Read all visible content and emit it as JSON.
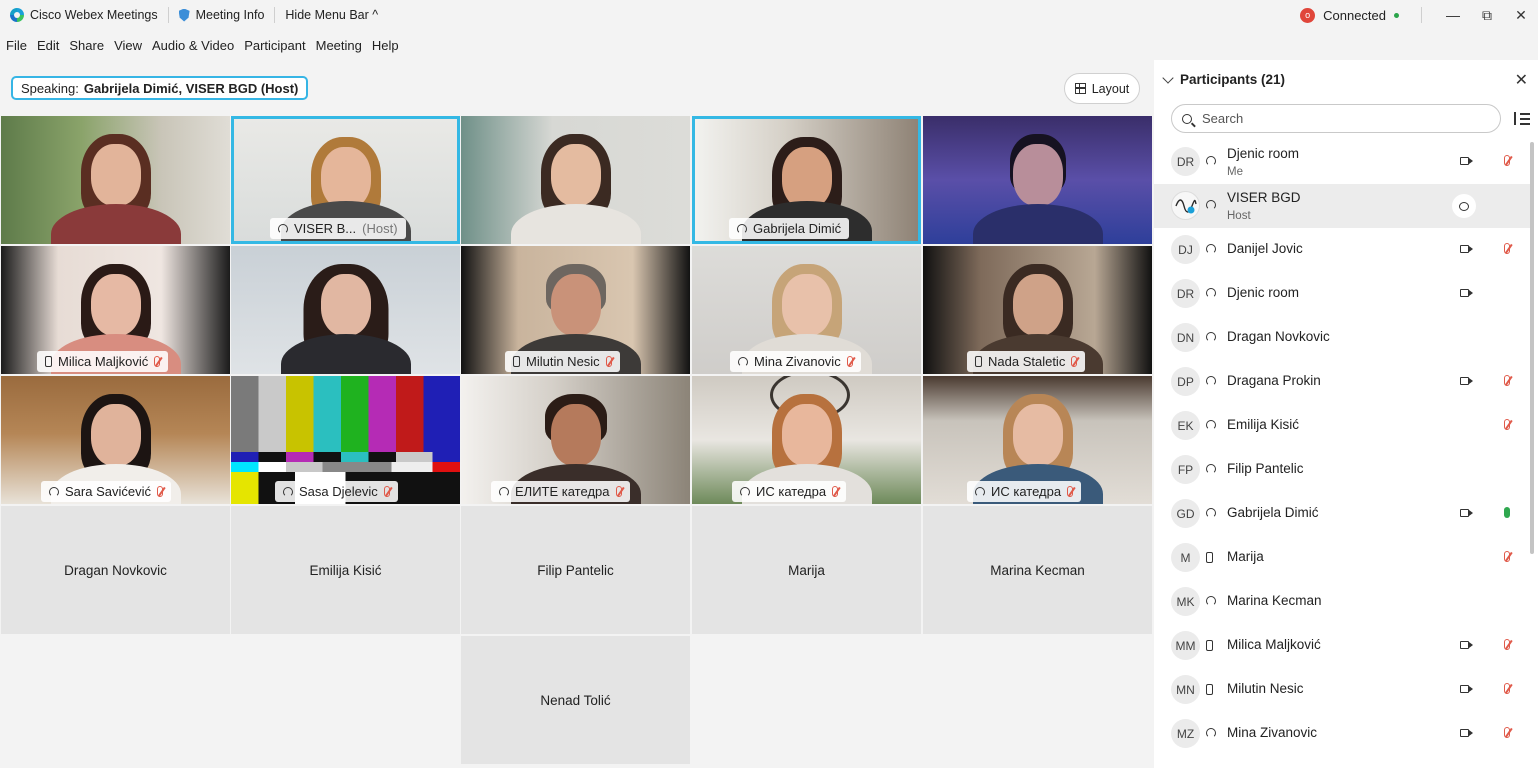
{
  "titlebar": {
    "app_name": "Cisco Webex Meetings",
    "meeting_info": "Meeting Info",
    "hide_menu": "Hide Menu Bar ^",
    "status": "Connected",
    "rec_badge": "o",
    "minimize": "—",
    "restore": "⧉",
    "close": "✕"
  },
  "menu": [
    "File",
    "Edit",
    "Share",
    "View",
    "Audio & Video",
    "Participant",
    "Meeting",
    "Help"
  ],
  "speaking": {
    "label": "Speaking:",
    "name": "Gabrijela Dimić, VISER BGD (Host)"
  },
  "layout_button": "Layout",
  "video_tiles": [
    {
      "name": "",
      "host": "",
      "icon": "none",
      "muted": false
    },
    {
      "name": "VISER B...",
      "host": "(Host)",
      "icon": "audio",
      "muted": false,
      "active": true
    },
    {
      "name": "",
      "host": "",
      "icon": "none",
      "muted": false
    },
    {
      "name": "Gabrijela Dimić",
      "host": "",
      "icon": "audio",
      "muted": false,
      "active": true
    },
    {
      "name": "",
      "host": "",
      "icon": "none",
      "muted": false
    },
    {
      "name": "Milica Maljković",
      "host": "",
      "icon": "phone",
      "muted": true
    },
    {
      "name": "",
      "host": "",
      "icon": "none",
      "muted": false
    },
    {
      "name": "Milutin Nesic",
      "host": "",
      "icon": "phone",
      "muted": true
    },
    {
      "name": "Mina Zivanovic",
      "host": "",
      "icon": "audio",
      "muted": true
    },
    {
      "name": "Nada Staletic",
      "host": "",
      "icon": "phone",
      "muted": true
    },
    {
      "name": "Sara Savićević",
      "host": "",
      "icon": "audio",
      "muted": true
    },
    {
      "name": "Sasa Djelevic",
      "host": "",
      "icon": "audio",
      "muted": true
    },
    {
      "name": "ЕЛИТЕ катедра",
      "host": "",
      "icon": "audio",
      "muted": true
    },
    {
      "name": "ИС катедра",
      "host": "",
      "icon": "audio",
      "muted": true
    },
    {
      "name": "ИС катедра",
      "host": "",
      "icon": "audio",
      "muted": true
    }
  ],
  "name_tiles": [
    "Dragan Novkovic",
    "Emilija Kisić",
    "Filip Pantelic",
    "Marija",
    "Marina Kecman",
    "Nenad Tolić"
  ],
  "panel": {
    "title": "Participants (21)",
    "close": "✕",
    "search_placeholder": "Search",
    "participants": [
      {
        "initials": "DR",
        "name": "Djenic room",
        "sub": "Me",
        "icon": "audio",
        "cam": true,
        "mic": "muted"
      },
      {
        "initials": "",
        "name": "VISER BGD",
        "sub": "Host",
        "icon": "audio",
        "cam": false,
        "mic": "chat",
        "selected": true
      },
      {
        "initials": "DJ",
        "name": "Danijel Jovic",
        "sub": "",
        "icon": "audio",
        "cam": true,
        "mic": "muted"
      },
      {
        "initials": "DR",
        "name": "Djenic room",
        "sub": "",
        "icon": "audio",
        "cam": true,
        "mic": "none"
      },
      {
        "initials": "DN",
        "name": "Dragan Novkovic",
        "sub": "",
        "icon": "audio",
        "cam": false,
        "mic": "none"
      },
      {
        "initials": "DP",
        "name": "Dragana Prokin",
        "sub": "",
        "icon": "audio",
        "cam": true,
        "mic": "muted"
      },
      {
        "initials": "EK",
        "name": "Emilija Kisić",
        "sub": "",
        "icon": "audio",
        "cam": false,
        "mic": "muted"
      },
      {
        "initials": "FP",
        "name": "Filip Pantelic",
        "sub": "",
        "icon": "audio",
        "cam": false,
        "mic": "none"
      },
      {
        "initials": "GD",
        "name": "Gabrijela Dimić",
        "sub": "",
        "icon": "audio",
        "cam": true,
        "mic": "on"
      },
      {
        "initials": "M",
        "name": "Marija",
        "sub": "",
        "icon": "phone",
        "cam": false,
        "mic": "muted"
      },
      {
        "initials": "MK",
        "name": "Marina Kecman",
        "sub": "",
        "icon": "audio",
        "cam": false,
        "mic": "none"
      },
      {
        "initials": "MM",
        "name": "Milica Maljković",
        "sub": "",
        "icon": "phone",
        "cam": true,
        "mic": "muted"
      },
      {
        "initials": "MN",
        "name": "Milutin Nesic",
        "sub": "",
        "icon": "phone",
        "cam": true,
        "mic": "muted"
      },
      {
        "initials": "MZ",
        "name": "Mina Zivanovic",
        "sub": "",
        "icon": "audio",
        "cam": true,
        "mic": "muted"
      }
    ]
  }
}
